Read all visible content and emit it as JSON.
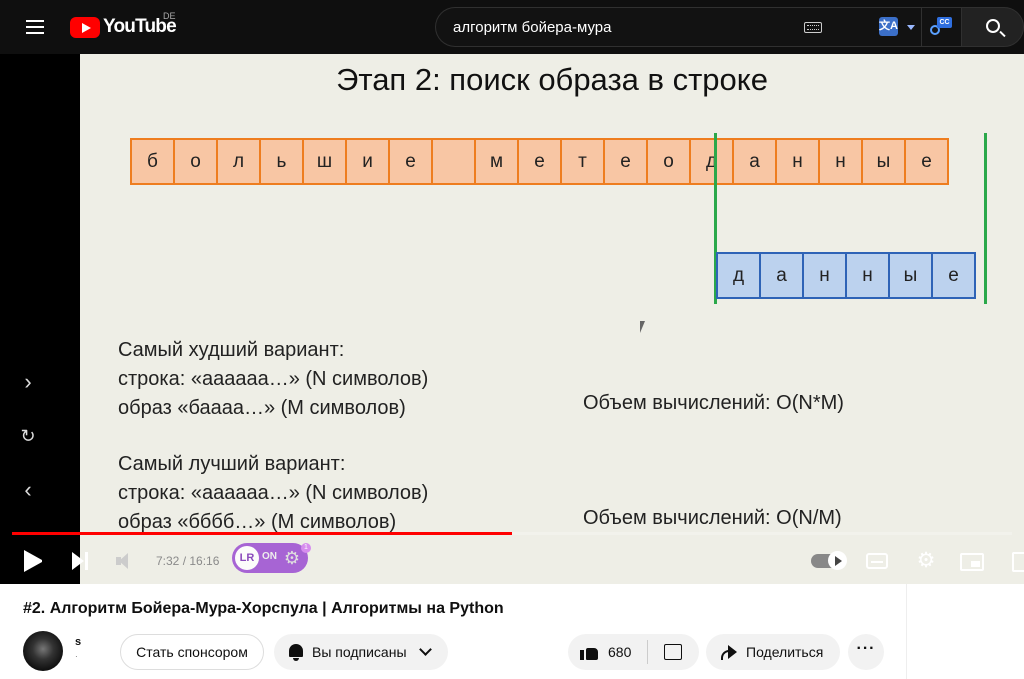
{
  "masthead": {
    "logo_text": "YouTube",
    "region": "DE",
    "search_value": "алгоритм бойера-мура",
    "translate_icon_glyph": "文A",
    "cc_tag": "CC"
  },
  "slide": {
    "title": "Этап 2: поиск образа в строке",
    "string_cells": [
      "б",
      "о",
      "л",
      "ь",
      "ш",
      "и",
      "е",
      "",
      "м",
      "е",
      "т",
      "е",
      "о",
      "д",
      "а",
      "н",
      "н",
      "ы",
      "е"
    ],
    "pattern_cells": [
      "д",
      "а",
      "н",
      "н",
      "ы",
      "е"
    ],
    "worst_heading": "Самый худший вариант:",
    "worst_string": "строка: «аааааа…» (N символов)",
    "worst_pattern": "образ «баааа…» (M символов)",
    "worst_cost": "Объем вычислений: O(N*M)",
    "best_heading": "Самый лучший вариант:",
    "best_string": "строка: «аааааа…» (N символов)",
    "best_pattern": "образ «бббб…» (M символов)",
    "best_cost": "Объем вычислений: O(N/M)"
  },
  "player": {
    "time_display": "7:32 / 16:16",
    "progress_fraction": 0.5,
    "ext_logo": "LR",
    "ext_state": "ON",
    "ext_badge": "1",
    "side_controls": [
      "chevron-right-icon",
      "refresh-icon",
      "chevron-left-icon"
    ]
  },
  "video": {
    "title": "#2. Алгоритм Бойера-Мура-Хорспула | Алгоритмы на Python",
    "channel_name": "s",
    "channel_subs": "·",
    "sponsor_label": "Стать спонсором",
    "subscribed_label": "Вы подписаны",
    "like_count": "680",
    "share_label": "Поделиться",
    "more_label": "···"
  },
  "colors": {
    "brand_red": "#ff0000",
    "string_cell_fill": "#f8c6a4",
    "string_cell_border": "#ee7d1f",
    "pattern_cell_fill": "#bcd2ee",
    "pattern_cell_border": "#2e63b6",
    "alignment_line": "#2aa84a"
  }
}
